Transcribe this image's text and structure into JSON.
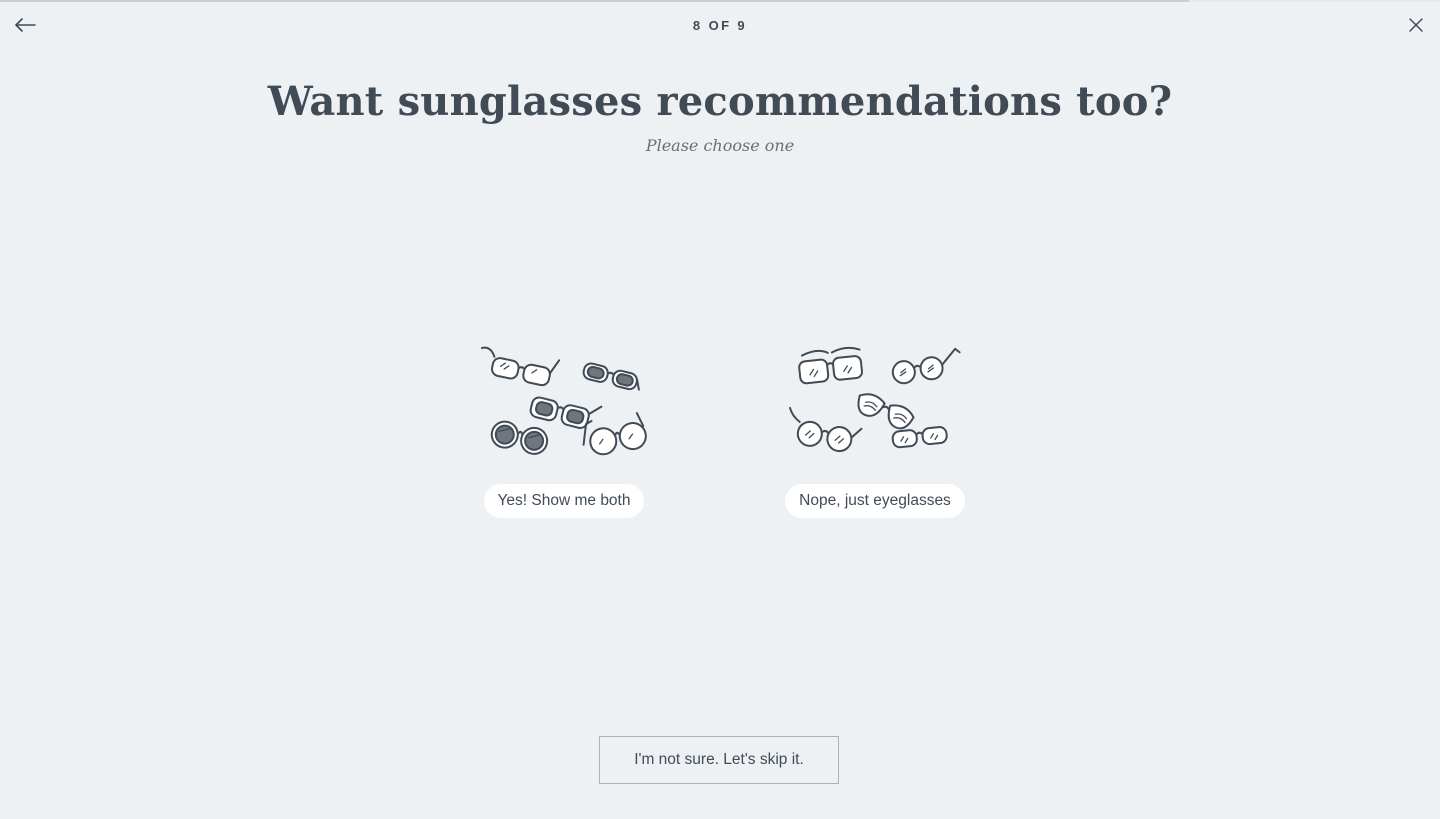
{
  "progress": {
    "current": 8,
    "total": 9,
    "fraction": 0.826
  },
  "header": {
    "step_label": "8 OF 9",
    "back_icon": "arrow-left-icon",
    "close_icon": "close-icon"
  },
  "question": {
    "title": "Want sunglasses recommendations too?",
    "subtitle": "Please choose one"
  },
  "options": [
    {
      "label": "Yes! Show me both",
      "icon": "sunglasses-and-eyeglasses-illustration"
    },
    {
      "label": "Nope, just eyeglasses",
      "icon": "eyeglasses-illustration"
    }
  ],
  "skip": {
    "label": "I'm not sure. Let's skip it."
  },
  "colors": {
    "background": "#edf1f4",
    "text": "#414b56",
    "pill": "#ffffff",
    "border": "#a9b2b9"
  }
}
